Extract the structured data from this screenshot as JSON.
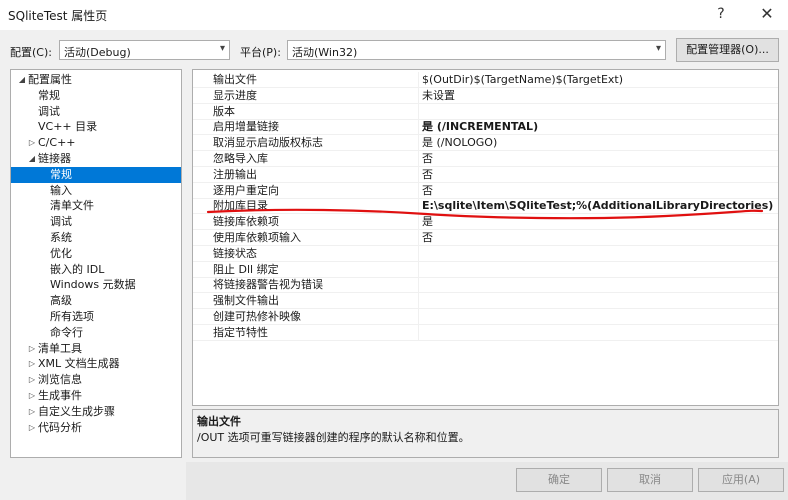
{
  "window": {
    "title": "SQliteTest 属性页",
    "help": "?",
    "close": "✕"
  },
  "config": {
    "config_label": "配置(C):",
    "config_value": "活动(Debug)",
    "platform_label": "平台(P):",
    "platform_value": "活动(Win32)",
    "manager_button": "配置管理器(O)..."
  },
  "tree": [
    {
      "label": "配置属性",
      "level": 0,
      "expander": "◢"
    },
    {
      "label": "常规",
      "level": 1,
      "expander": ""
    },
    {
      "label": "调试",
      "level": 1,
      "expander": ""
    },
    {
      "label": "VC++ 目录",
      "level": 1,
      "expander": ""
    },
    {
      "label": "C/C++",
      "level": 1,
      "expander": "▷"
    },
    {
      "label": "链接器",
      "level": 1,
      "expander": "◢"
    },
    {
      "label": "常规",
      "level": 2,
      "expander": "",
      "selected": true
    },
    {
      "label": "输入",
      "level": 2,
      "expander": ""
    },
    {
      "label": "清单文件",
      "level": 2,
      "expander": ""
    },
    {
      "label": "调试",
      "level": 2,
      "expander": ""
    },
    {
      "label": "系统",
      "level": 2,
      "expander": ""
    },
    {
      "label": "优化",
      "level": 2,
      "expander": ""
    },
    {
      "label": "嵌入的 IDL",
      "level": 2,
      "expander": ""
    },
    {
      "label": "Windows 元数据",
      "level": 2,
      "expander": ""
    },
    {
      "label": "高级",
      "level": 2,
      "expander": ""
    },
    {
      "label": "所有选项",
      "level": 2,
      "expander": ""
    },
    {
      "label": "命令行",
      "level": 2,
      "expander": ""
    },
    {
      "label": "清单工具",
      "level": 1,
      "expander": "▷"
    },
    {
      "label": "XML 文档生成器",
      "level": 1,
      "expander": "▷"
    },
    {
      "label": "浏览信息",
      "level": 1,
      "expander": "▷"
    },
    {
      "label": "生成事件",
      "level": 1,
      "expander": "▷"
    },
    {
      "label": "自定义生成步骤",
      "level": 1,
      "expander": "▷"
    },
    {
      "label": "代码分析",
      "level": 1,
      "expander": "▷"
    }
  ],
  "properties": [
    {
      "name": "输出文件",
      "value": "$(OutDir)$(TargetName)$(TargetExt)",
      "bold": false
    },
    {
      "name": "显示进度",
      "value": "未设置",
      "bold": false
    },
    {
      "name": "版本",
      "value": "",
      "bold": false
    },
    {
      "name": "启用增量链接",
      "value": "是 (/INCREMENTAL)",
      "bold": true
    },
    {
      "name": "取消显示启动版权标志",
      "value": "是 (/NOLOGO)",
      "bold": false
    },
    {
      "name": "忽略导入库",
      "value": "否",
      "bold": false
    },
    {
      "name": "注册输出",
      "value": "否",
      "bold": false
    },
    {
      "name": "逐用户重定向",
      "value": "否",
      "bold": false
    },
    {
      "name": "附加库目录",
      "value": "E:\\sqlite\\Item\\SQliteTest;%(AdditionalLibraryDirectories)",
      "bold": true
    },
    {
      "name": "链接库依赖项",
      "value": "是",
      "bold": false
    },
    {
      "name": "使用库依赖项输入",
      "value": "否",
      "bold": false
    },
    {
      "name": "链接状态",
      "value": "",
      "bold": false
    },
    {
      "name": "阻止 Dll 绑定",
      "value": "",
      "bold": false
    },
    {
      "name": "将链接器警告视为错误",
      "value": "",
      "bold": false
    },
    {
      "name": "强制文件输出",
      "value": "",
      "bold": false
    },
    {
      "name": "创建可热修补映像",
      "value": "",
      "bold": false
    },
    {
      "name": "指定节特性",
      "value": "",
      "bold": false
    }
  ],
  "description": {
    "title": "输出文件",
    "text": "/OUT 选项可重写链接器创建的程序的默认名称和位置。"
  },
  "buttons": {
    "ok": "确定",
    "cancel": "取消",
    "apply": "应用(A)"
  },
  "colors": {
    "selection": "#0078d7",
    "annotation": "#e01010"
  }
}
